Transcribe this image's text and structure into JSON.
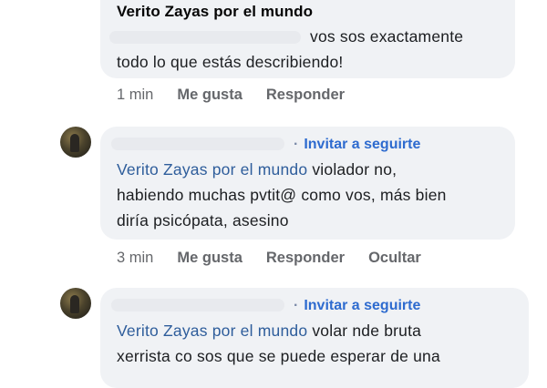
{
  "comments": [
    {
      "author": "Verito Zayas por el mundo",
      "line1": "vos sos exactamente",
      "line2": "todo lo que estás describiendo!",
      "time": "1 min",
      "like": "Me gusta",
      "reply": "Responder"
    },
    {
      "invite": "Invitar a seguirte",
      "mention": "Verito Zayas por el mundo",
      "line1_rest": " violador no,",
      "line2": "habiendo muchas pvtit@ como vos, más bien",
      "line3": "diría psicópata, asesino",
      "time": "3 min",
      "like": "Me gusta",
      "reply": "Responder",
      "hide": "Ocultar"
    },
    {
      "invite": "Invitar a seguirte",
      "mention": "Verito Zayas por el mundo",
      "line1_rest": " volar nde bruta",
      "line2": "xerrista co sos que se puede esperar de una"
    }
  ],
  "dot": "·"
}
